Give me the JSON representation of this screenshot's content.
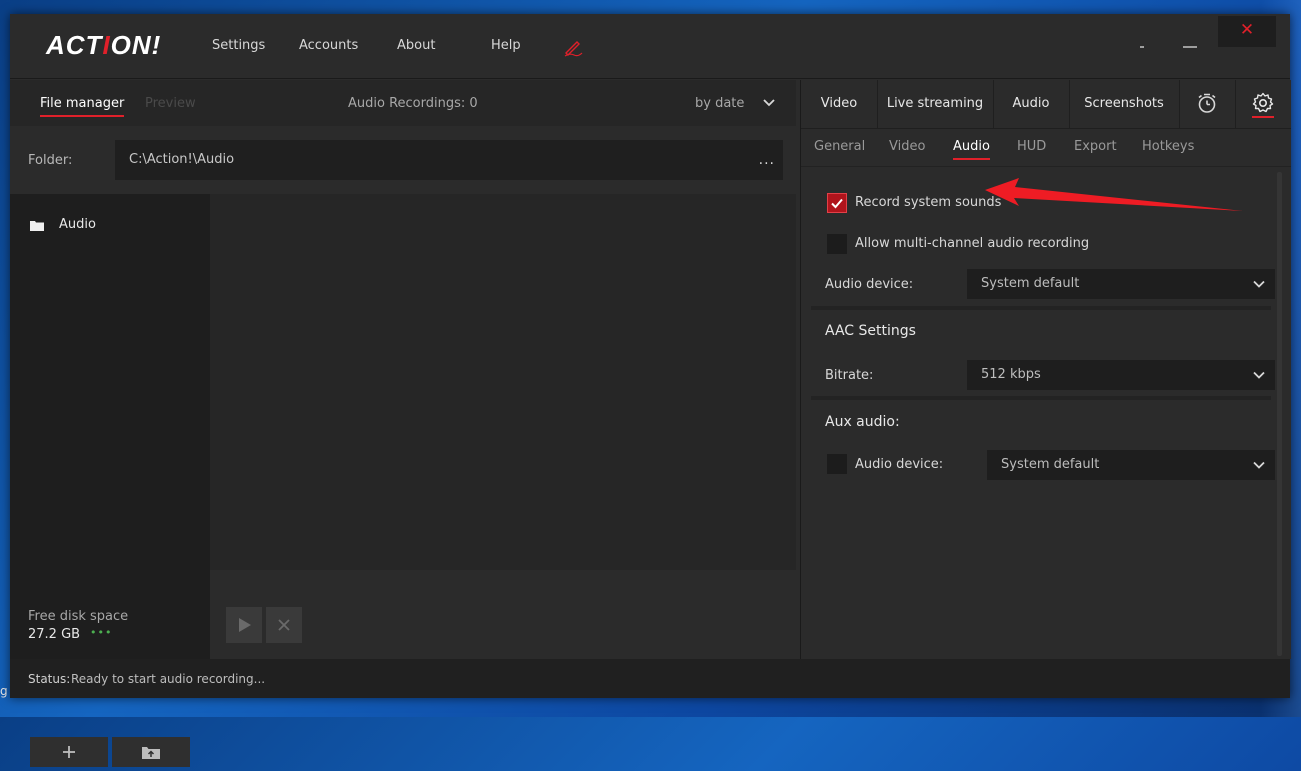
{
  "app": {
    "logo_left": "ACT",
    "logo_mid": "I",
    "logo_right": "ON!",
    "menu": [
      "Settings",
      "Accounts",
      "About",
      "Help"
    ],
    "close_glyph": "✕"
  },
  "file_manager": {
    "tab_active": "File manager",
    "tab_inactive": "Preview",
    "count_label": "Audio Recordings: 0",
    "sort_label": "by date",
    "folder_label": "Folder:",
    "folder_path": "C:\\Action!\\Audio",
    "folder_more": "...",
    "tree_items": [
      {
        "label": "Audio",
        "icon": "folder-icon"
      }
    ],
    "add_glyph": "+",
    "disk_label": "Free disk space",
    "disk_value": "27.2 GB",
    "disk_indicator": "•••"
  },
  "right_tabs": {
    "tabs": [
      "Video",
      "Live streaming",
      "Audio",
      "Screenshots"
    ],
    "icons": [
      "timer-icon",
      "gear-icon"
    ],
    "active_icon": "gear-icon"
  },
  "settings_tabs": {
    "tabs": [
      "General",
      "Video",
      "Audio",
      "HUD",
      "Export",
      "Hotkeys"
    ],
    "active": "Audio"
  },
  "audio_settings": {
    "record_system_sounds": {
      "label": "Record system sounds",
      "checked": true
    },
    "multichannel": {
      "label": "Allow multi-channel audio recording",
      "checked": false
    },
    "device_label": "Audio device:",
    "device_value": "System default",
    "aac_title": "AAC Settings",
    "bitrate_label": "Bitrate:",
    "bitrate_value": "512 kbps",
    "aux_title": "Aux audio:",
    "aux_device": {
      "label": "Audio device:",
      "checked": false
    },
    "aux_device_value": "System default"
  },
  "status": {
    "key": "Status:",
    "value": "Ready to start audio recording..."
  },
  "desktop": {
    "edge_text": "g"
  },
  "colors": {
    "accent": "#e0202a",
    "window_bg": "#2b2b2b",
    "dark_bg": "#1e1e1e",
    "ok_green": "#4caf50"
  }
}
